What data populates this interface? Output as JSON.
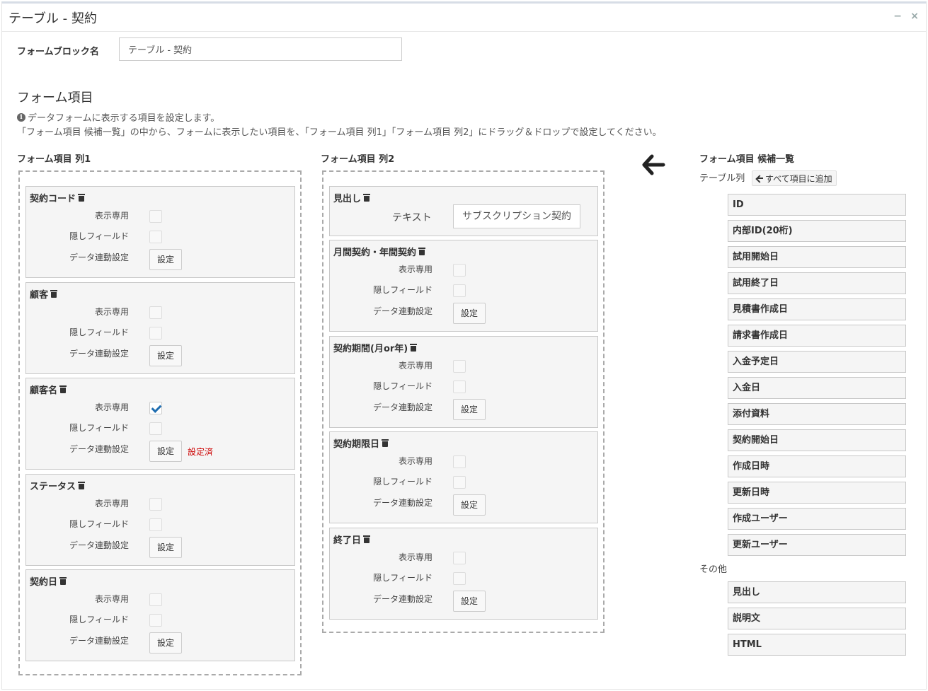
{
  "window": {
    "title": "テーブル - 契約",
    "min_glyph": "−",
    "close_glyph": "×"
  },
  "block_name": {
    "label": "フォームブロック名",
    "value": "テーブル - 契約"
  },
  "section": {
    "title": "フォーム項目",
    "desc_line1": "データフォームに表示する項目を設定します。",
    "desc_line2": "「フォーム項目 候補一覧」の中から、フォームに表示したい項目を、「フォーム項目 列1」「フォーム項目 列2」にドラッグ＆ドロップで設定してください。",
    "info_glyph": "i"
  },
  "labels": {
    "display_only": "表示専用",
    "hidden_field": "隠しフィールド",
    "data_link": "データ連動設定",
    "settings_button": "設定",
    "configured": "設定済",
    "text": "テキスト"
  },
  "column1": {
    "title": "フォーム項目 列1",
    "fields": [
      {
        "name": "契約コード",
        "display_only": false,
        "hidden": false,
        "configured": false
      },
      {
        "name": "顧客",
        "display_only": false,
        "hidden": false,
        "configured": false
      },
      {
        "name": "顧客名",
        "display_only": true,
        "hidden": false,
        "configured": true
      },
      {
        "name": "ステータス",
        "display_only": false,
        "hidden": false,
        "configured": false
      },
      {
        "name": "契約日",
        "display_only": false,
        "hidden": false,
        "configured": false
      }
    ]
  },
  "column2": {
    "title": "フォーム項目 列2",
    "heading": {
      "name": "見出し",
      "text_value": "サブスクリプション契約"
    },
    "fields": [
      {
        "name": "月間契約・年間契約",
        "display_only": false,
        "hidden": false,
        "configured": false
      },
      {
        "name": "契約期間(月or年)",
        "display_only": false,
        "hidden": false,
        "configured": false
      },
      {
        "name": "契約期限日",
        "display_only": false,
        "hidden": false,
        "configured": false
      },
      {
        "name": "終了日",
        "display_only": false,
        "hidden": false,
        "configured": false
      }
    ]
  },
  "candidates": {
    "title": "フォーム項目 候補一覧",
    "table_label": "テーブル列",
    "add_all_label": "すべて項目に追加",
    "table_items": [
      "ID",
      "内部ID(20桁)",
      "試用開始日",
      "試用終了日",
      "見積書作成日",
      "請求書作成日",
      "入金予定日",
      "入金日",
      "添付資料",
      "契約開始日",
      "作成日時",
      "更新日時",
      "作成ユーザー",
      "更新ユーザー"
    ],
    "other_label": "その他",
    "other_items": [
      "見出し",
      "説明文",
      "HTML"
    ]
  },
  "colors": {
    "check": "#1f6db0",
    "configured": "#cc0000",
    "card_bg": "#f5f5f5"
  },
  "icons": {
    "trash": "trash-icon",
    "arrow": "arrow-left-icon",
    "info": "info-icon"
  }
}
